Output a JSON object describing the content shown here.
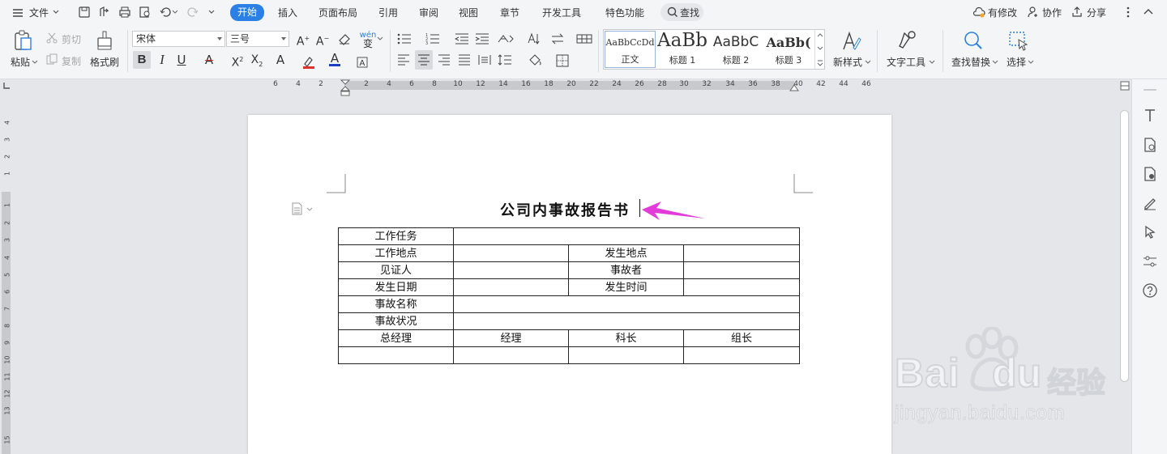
{
  "menubar": {
    "file_label": "文件",
    "tabs": [
      "开始",
      "插入",
      "页面布局",
      "引用",
      "审阅",
      "视图",
      "章节",
      "开发工具",
      "特色功能"
    ],
    "search_label": "查找",
    "modified_label": "有修改",
    "collab_label": "协作",
    "share_label": "分享"
  },
  "ribbon": {
    "paste_label": "粘贴",
    "cut_label": "剪切",
    "copy_label": "复制",
    "format_painter_label": "格式刷",
    "font_name": "宋体",
    "font_size": "三号",
    "styles": [
      {
        "sample": "AaBbCcDd",
        "name": "正文"
      },
      {
        "sample": "AaBb",
        "name": "标题 1"
      },
      {
        "sample": "AaBbC",
        "name": "标题 2"
      },
      {
        "sample": "AaBb(",
        "name": "标题 3"
      }
    ],
    "new_style_label": "新样式",
    "text_tools_label": "文字工具",
    "find_replace_label": "查找替换",
    "select_label": "选择"
  },
  "ruler": {
    "h_ticks": [
      "6",
      "4",
      "2",
      "2",
      "4",
      "6",
      "8",
      "10",
      "12",
      "14",
      "16",
      "18",
      "20",
      "22",
      "24",
      "26",
      "28",
      "30",
      "32",
      "34",
      "36",
      "38",
      "40",
      "42",
      "44",
      "46"
    ],
    "v_ticks": [
      "4",
      "3",
      "2",
      "1",
      "1",
      "2",
      "3",
      "4",
      "5",
      "6",
      "7",
      "8",
      "9",
      "10",
      "11",
      "12",
      "13",
      "15"
    ]
  },
  "document": {
    "title": "公司内事故报告书",
    "table": {
      "r1": {
        "c1": "工作任务"
      },
      "r2": {
        "c1": "工作地点",
        "c3": "发生地点"
      },
      "r3": {
        "c1": "见证人",
        "c3": "事故者"
      },
      "r4": {
        "c1": "发生日期",
        "c3": "发生时间"
      },
      "r5": {
        "c1": "事故名称"
      },
      "r6": {
        "c1": "事故状况"
      },
      "r7": {
        "c1": "总经理",
        "c2": "经理",
        "c3": "科长",
        "c4": "组长"
      }
    }
  },
  "watermark": {
    "brand": "Bai",
    "brand_2": "du",
    "brand_cn": "经验",
    "url": "jingyan.baidu.com"
  },
  "colors": {
    "accent": "#2a80e4",
    "arrow": "#e33bd9",
    "font_red": "#e0302a",
    "highlight": "#e0302a"
  }
}
